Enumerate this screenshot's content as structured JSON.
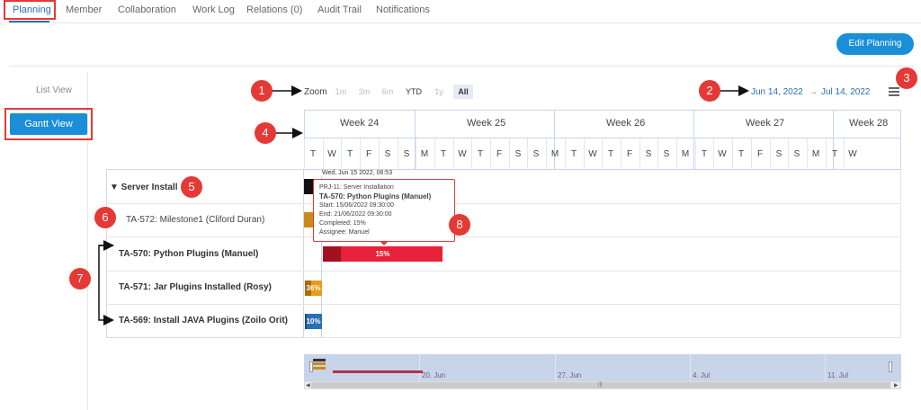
{
  "tabs": [
    "Planning",
    "Member",
    "Collaboration",
    "Work Log",
    "Relations (0)",
    "Audit Trail",
    "Notifications"
  ],
  "edit_planning": "Edit Planning",
  "views": {
    "list": "List View",
    "gantt": "Gantt View"
  },
  "zoom": {
    "label": "Zoom",
    "options": [
      "1m",
      "3m",
      "6m",
      "YTD",
      "1y",
      "All"
    ]
  },
  "date_range": {
    "from": "Jun 14, 2022",
    "arrow": "→",
    "to": "Jul 14, 2022"
  },
  "weeks": [
    "Week 24",
    "Week 25",
    "Week 26",
    "Week 27",
    "Week 28"
  ],
  "days": [
    "T",
    "W",
    "T",
    "F",
    "S",
    "S",
    "M",
    "T",
    "W",
    "T",
    "F",
    "S",
    "S",
    "M",
    "T",
    "W",
    "T",
    "F",
    "S",
    "S",
    "M",
    "T",
    "W",
    "T",
    "F",
    "S",
    "S",
    "M",
    "T",
    "W"
  ],
  "tasks": [
    {
      "label": "▼ Server Install",
      "bold": true
    },
    {
      "label": "TA-572: Milestone1 (Cliford Duran)",
      "bold": false
    },
    {
      "label": "TA-570: Python Plugins (Manuel)",
      "bold": true
    },
    {
      "label": "TA-571: Jar Plugins Installed (Rosy)",
      "bold": true
    },
    {
      "label": "TA-569: Install JAVA Plugins (Zoilo Orit)",
      "bold": true
    }
  ],
  "bars": [
    {
      "label": "",
      "color": "#111111"
    },
    {
      "label": "",
      "color": "#c98a1a"
    },
    {
      "label": "15%",
      "color": "#e8213a",
      "complete_color": "#a3101f",
      "percent": 15
    },
    {
      "label": "36%",
      "color": "#e89b1a",
      "complete_color": "#b06a0a",
      "percent": 36
    },
    {
      "label": "10%",
      "color": "#2a6fb5",
      "complete_color": "#1c4f85",
      "percent": 10
    }
  ],
  "hover_date": "Wed, Jun 15 2022, 06:53",
  "tooltip": {
    "project": "PRJ-11: Server Installation",
    "title": "TA-570: Python Plugins (Manuel)",
    "start": "Start: 15/06/2022 09:30:00",
    "end": "End: 21/06/2022 09:30:00",
    "completed": "Completed: 15%",
    "assignee": "Assignee: Manuel"
  },
  "navigator_labels": [
    "20. Jun",
    "27. Jun",
    "4. Jul",
    "11. Jul"
  ],
  "markers": [
    "1",
    "2",
    "3",
    "4",
    "5",
    "6",
    "7",
    "8"
  ],
  "colors": {
    "accent": "#1a8fd8",
    "marker": "#e53935",
    "link": "#2a6fb5"
  }
}
